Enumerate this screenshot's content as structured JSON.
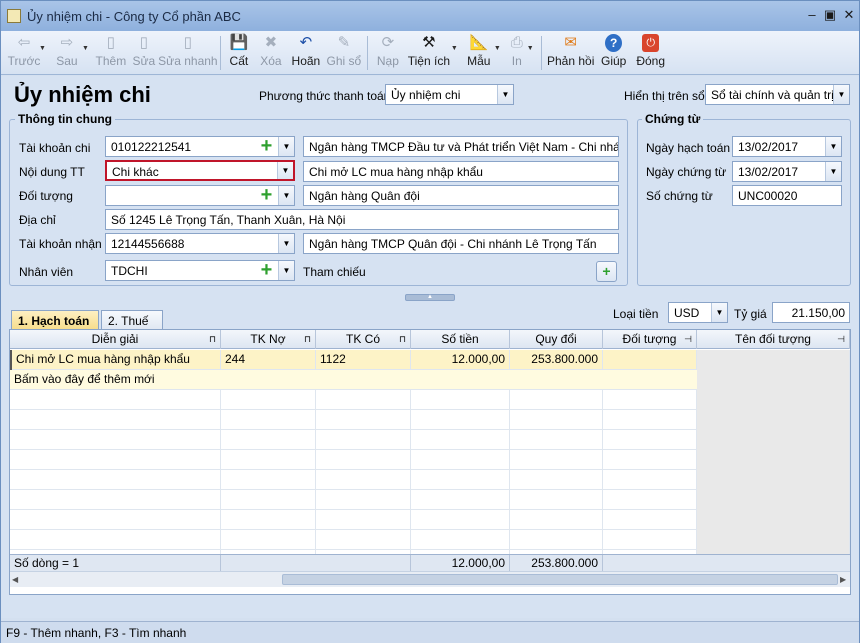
{
  "window": {
    "title": "Ủy nhiệm chi - Công ty Cổ phần ABC"
  },
  "toolbar": [
    {
      "name": "prev",
      "label": "Trước",
      "icon": "arrow-left-icon",
      "glyph": "⇦",
      "disabled": true,
      "caret": true
    },
    {
      "name": "next",
      "label": "Sau",
      "icon": "arrow-right-icon",
      "glyph": "⇨",
      "disabled": true,
      "caret": true
    },
    {
      "name": "add",
      "label": "Thêm",
      "icon": "add-document-icon",
      "glyph": "▯",
      "disabled": true
    },
    {
      "name": "edit",
      "label": "Sửa",
      "icon": "edit-document-icon",
      "glyph": "▯",
      "disabled": true
    },
    {
      "name": "quick-edit",
      "label": "Sửa nhanh",
      "icon": "quick-edit-icon",
      "glyph": "▯",
      "disabled": true
    },
    {
      "name": "save",
      "label": "Cất",
      "icon": "save-icon",
      "glyph": "💾",
      "disabled": false
    },
    {
      "name": "delete",
      "label": "Xóa",
      "icon": "delete-icon",
      "glyph": "✖",
      "disabled": true
    },
    {
      "name": "undo",
      "label": "Hoãn",
      "icon": "undo-icon",
      "glyph": "↶",
      "disabled": false
    },
    {
      "name": "post",
      "label": "Ghi sổ",
      "icon": "pencil-icon",
      "glyph": "✎",
      "disabled": true
    },
    {
      "name": "load",
      "label": "Nạp",
      "icon": "reload-icon",
      "glyph": "⟳",
      "disabled": true
    },
    {
      "name": "utilities",
      "label": "Tiện ích",
      "icon": "tools-icon",
      "glyph": "⚒",
      "disabled": false,
      "caret": true
    },
    {
      "name": "template",
      "label": "Mẫu",
      "icon": "template-icon",
      "glyph": "📐",
      "disabled": false,
      "caret": true
    },
    {
      "name": "print",
      "label": "In",
      "icon": "printer-icon",
      "glyph": "⎙",
      "disabled": true,
      "caret": true
    },
    {
      "name": "feedback",
      "label": "Phản hồi",
      "icon": "mail-icon",
      "glyph": "✉",
      "disabled": false
    },
    {
      "name": "help",
      "label": "Giúp",
      "icon": "help-icon",
      "glyph": "?",
      "disabled": false
    },
    {
      "name": "close",
      "label": "Đóng",
      "icon": "power-icon",
      "glyph": "⏻",
      "disabled": false
    }
  ],
  "form": {
    "heading": "Ủy nhiệm chi",
    "payment_method_label": "Phương thức thanh toán",
    "payment_method_value": "Ủy nhiệm chi",
    "display_on_book_label": "Hiển thị trên sổ",
    "display_on_book_value": "Sổ tài chính và quản trị"
  },
  "general_info": {
    "title": "Thông tin chung",
    "account_label": "Tài khoản chi",
    "account_value": "010122212541",
    "account_bank": "Ngân hàng TMCP Đầu tư và Phát triển Việt Nam - Chi nhánh",
    "content_label": "Nội dung TT",
    "content_value": "Chi khác",
    "content_desc": "Chi mở LC mua hàng nhập khẩu",
    "object_label": "Đối tượng",
    "object_value": "",
    "object_name": "Ngân hàng Quân đội",
    "address_label": "Địa chỉ",
    "address_value": "Số 1245 Lê Trọng Tấn, Thanh Xuân, Hà Nội",
    "recv_account_label": "Tài khoản nhận",
    "recv_account_value": "12144556688",
    "recv_bank": "Ngân hàng TMCP Quân đội - Chi nhánh Lê Trọng Tấn",
    "employee_label": "Nhân viên",
    "employee_value": "TDCHI",
    "reference_label": "Tham chiếu"
  },
  "voucher": {
    "title": "Chứng từ",
    "posting_date_label": "Ngày hạch toán",
    "posting_date_value": "13/02/2017",
    "voucher_date_label": "Ngày chứng từ",
    "voucher_date_value": "13/02/2017",
    "voucher_no_label": "Số chứng từ",
    "voucher_no_value": "UNC00020"
  },
  "tabs": [
    {
      "label": "1. Hạch toán",
      "active": true
    },
    {
      "label": "2. Thuế",
      "active": false
    }
  ],
  "currency": {
    "label": "Loại tiền",
    "value": "USD",
    "rate_label": "Tỷ giá",
    "rate_value": "21.150,00"
  },
  "grid": {
    "columns": [
      "Diễn giải",
      "TK Nợ",
      "TK Có",
      "Số tiền",
      "Quy đổi",
      "Đối tượng",
      "Tên đối tượng"
    ],
    "rows": [
      [
        "Chi mở LC mua hàng nhập khẩu",
        "244",
        "1122",
        "12.000,00",
        "253.800.000",
        "",
        ""
      ]
    ],
    "add_row_hint": "Bấm vào đây để thêm mới",
    "footer_count": "Số dòng = 1",
    "footer_amount": "12.000,00",
    "footer_converted": "253.800.000"
  },
  "statusbar": {
    "text": "F9 - Thêm nhanh, F3 - Tìm nhanh"
  },
  "colors": {
    "highlight_border": "#c0152a",
    "selected_row": "#fdf3c7",
    "add_row": "#fffbe0"
  }
}
